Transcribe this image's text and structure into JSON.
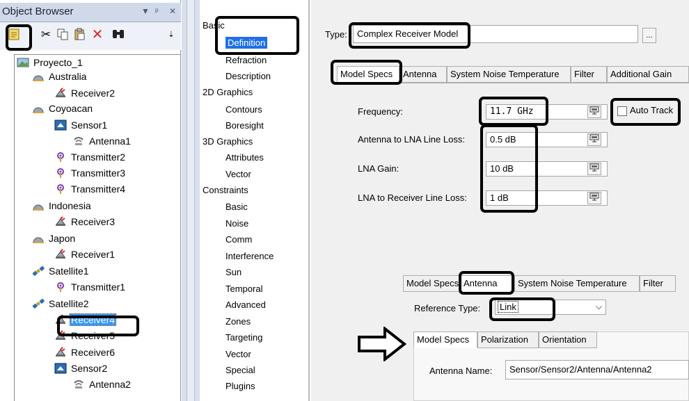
{
  "object_browser": {
    "title": "Object Browser",
    "header_icons": [
      "dropdown-arrow-icon",
      "pin-icon",
      "close-icon"
    ],
    "toolbar": [
      "new-object-icon",
      "cut-icon",
      "copy-icon",
      "paste-icon",
      "delete-icon",
      "find-icon",
      "overflow-icon"
    ],
    "tree": [
      {
        "label": "Proyecto_1",
        "icon": "scenario-icon",
        "level": 0
      },
      {
        "label": "Australia",
        "icon": "facility-icon",
        "level": 1
      },
      {
        "label": "Receiver2",
        "icon": "receiver-icon",
        "level": 2
      },
      {
        "label": "Coyoacan",
        "icon": "facility-icon",
        "level": 1
      },
      {
        "label": "Sensor1",
        "icon": "sensor-icon",
        "level": 2
      },
      {
        "label": "Antenna1",
        "icon": "antenna-icon",
        "level": 3
      },
      {
        "label": "Transmitter2",
        "icon": "transmitter-icon",
        "level": 2
      },
      {
        "label": "Transmitter3",
        "icon": "transmitter-icon",
        "level": 2
      },
      {
        "label": "Transmitter4",
        "icon": "transmitter-icon",
        "level": 2
      },
      {
        "label": "Indonesia",
        "icon": "facility-icon",
        "level": 1
      },
      {
        "label": "Receiver3",
        "icon": "receiver-icon",
        "level": 2
      },
      {
        "label": "Japon",
        "icon": "facility-icon",
        "level": 1
      },
      {
        "label": "Receiver1",
        "icon": "receiver-icon",
        "level": 2
      },
      {
        "label": "Satellite1",
        "icon": "satellite-icon",
        "level": 1
      },
      {
        "label": "Transmitter1",
        "icon": "transmitter-icon",
        "level": 2
      },
      {
        "label": "Satellite2",
        "icon": "satellite-icon",
        "level": 1
      },
      {
        "label": "Receiver4",
        "icon": "receiver-icon",
        "level": 2,
        "selected": true
      },
      {
        "label": "Receiver5",
        "icon": "receiver-icon",
        "level": 2
      },
      {
        "label": "Receiver6",
        "icon": "receiver-icon",
        "level": 2
      },
      {
        "label": "Sensor2",
        "icon": "sensor-icon",
        "level": 2
      },
      {
        "label": "Antenna2",
        "icon": "antenna-icon",
        "level": 3
      }
    ]
  },
  "categories": [
    {
      "label": "Basic",
      "indent": false
    },
    {
      "label": "Definition",
      "indent": true,
      "selected": true
    },
    {
      "label": "Refraction",
      "indent": true
    },
    {
      "label": "Description",
      "indent": true
    },
    {
      "label": "2D Graphics",
      "indent": false
    },
    {
      "label": "Contours",
      "indent": true
    },
    {
      "label": "Boresight",
      "indent": true
    },
    {
      "label": "3D Graphics",
      "indent": false
    },
    {
      "label": "Attributes",
      "indent": true
    },
    {
      "label": "Vector",
      "indent": true
    },
    {
      "label": "Constraints",
      "indent": false
    },
    {
      "label": "Basic",
      "indent": true
    },
    {
      "label": "Noise",
      "indent": true
    },
    {
      "label": "Comm",
      "indent": true
    },
    {
      "label": "Interference",
      "indent": true
    },
    {
      "label": "Sun",
      "indent": true
    },
    {
      "label": "Temporal",
      "indent": true
    },
    {
      "label": "Advanced",
      "indent": true
    },
    {
      "label": "Zones",
      "indent": true
    },
    {
      "label": "Targeting",
      "indent": true
    },
    {
      "label": "Vector",
      "indent": true
    },
    {
      "label": "Special",
      "indent": true
    },
    {
      "label": "Plugins",
      "indent": true
    }
  ],
  "properties": {
    "type_label": "Type:",
    "type_value": "Complex Receiver Model",
    "type_button": "...",
    "main_tabs": [
      "Model Specs",
      "Antenna",
      "System Noise Temperature",
      "Filter",
      "Additional Gain"
    ],
    "fields": [
      {
        "label": "Frequency:",
        "value": "11.7 GHz",
        "font": "mono"
      },
      {
        "label": "Antenna to LNA Line Loss:",
        "value": "0.5 dB"
      },
      {
        "label": "LNA Gain:",
        "value": "10 dB"
      },
      {
        "label": "LNA to Receiver Line Loss:",
        "value": "1 dB"
      }
    ],
    "auto_track_label": "Auto Track",
    "auto_track_checked": false,
    "inset": {
      "tabs": [
        "Model Specs",
        "Antenna",
        "System Noise Temperature",
        "Filter"
      ],
      "reference_type_label": "Reference Type:",
      "reference_type_value": "Link",
      "sub_tabs": [
        "Model Specs",
        "Polarization",
        "Orientation"
      ],
      "antenna_name_label": "Antenna Name:",
      "antenna_name_value": "Sensor/Sensor2/Antenna/Antenna2"
    }
  }
}
